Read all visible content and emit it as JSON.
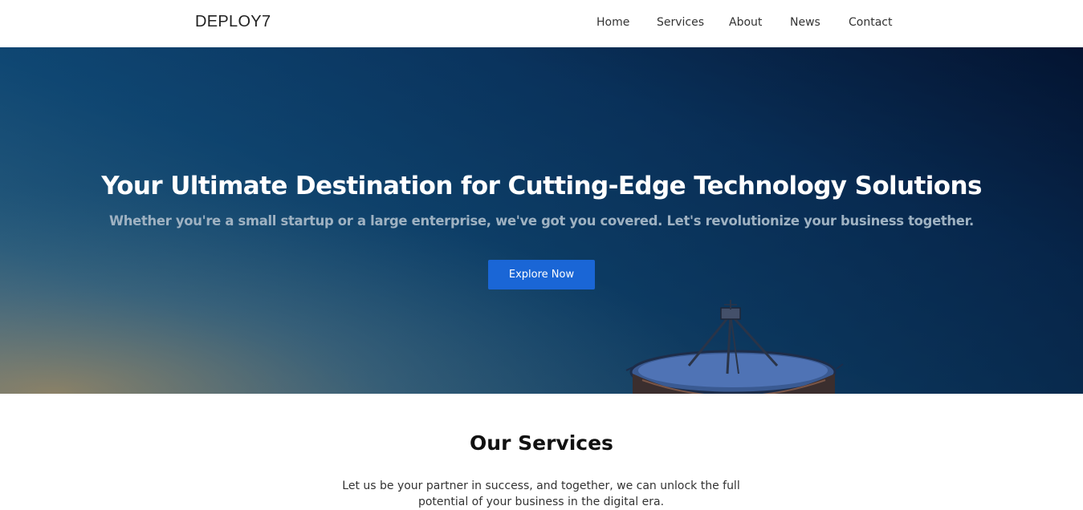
{
  "navbar": {
    "brand": "DEPLOY7",
    "links": [
      "Home",
      "Services",
      "About",
      "News",
      "Contact"
    ]
  },
  "hero": {
    "title": "Your Ultimate Destination for Cutting-Edge Technology Solutions",
    "subtitle": "Whether you're a small startup or a large enterprise, we've got you covered. Let's revolutionize your business together.",
    "cta_label": "Explore Now"
  },
  "services": {
    "title": "Our Services",
    "description": "Let us be your partner in success, and together, we can unlock the full potential of your business in the digital era."
  },
  "colors": {
    "accent": "#1a66d6",
    "hero_dark": "#061a3a",
    "hero_mid": "#114f7c"
  }
}
